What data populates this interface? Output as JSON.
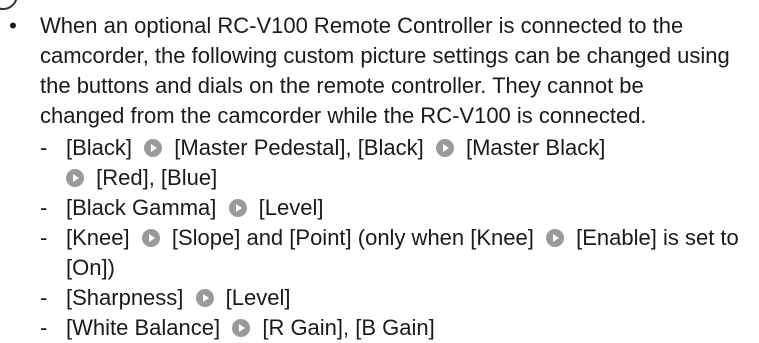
{
  "paragraph": {
    "bullet": "•",
    "lines": [
      "When an optional RC-V100 Remote Controller is connected to the",
      "camcorder, the following custom picture settings can be changed using",
      "the buttons and dials on the remote controller. They cannot be",
      "changed from the camcorder while the RC-V100 is connected."
    ]
  },
  "items": [
    {
      "dash": "-",
      "a": "[Black]",
      "b": "[Master Pedestal], [Black]",
      "c": "[Master Black]",
      "d": "[Red], [Blue]"
    },
    {
      "dash": "-",
      "a": "[Black Gamma]",
      "b": "[Level]"
    },
    {
      "dash": "-",
      "a": "[Knee]",
      "b": "[Slope] and [Point] (only when [Knee]",
      "c": "[Enable] is set to",
      "d": "[On])"
    },
    {
      "dash": "-",
      "a": "[Sharpness]",
      "b": "[Level]"
    },
    {
      "dash": "-",
      "a": "[White Balance]",
      "b": "[R Gain], [B Gain]"
    }
  ],
  "icons": {
    "note": "note-circle-icon",
    "arrow": "menu-arrow-icon",
    "arrow_color": "#9a9a9a"
  }
}
